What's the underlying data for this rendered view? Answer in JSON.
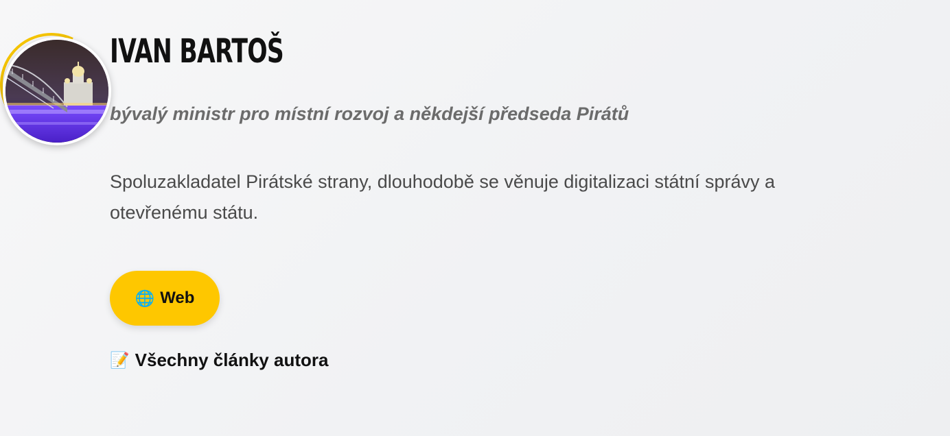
{
  "author": {
    "name": "IVAN BARTOŠ",
    "role": "bývalý ministr pro místní rozvoj a někdejší předseda Pirátů",
    "bio": "Spoluzakladatel Pirátské strany, dlouhodobě se věnuje digitalizaci státní správy a otevřenému státu.",
    "avatar_alt": "avatar"
  },
  "links": {
    "web": {
      "icon": "🌐",
      "icon_name": "globe-icon",
      "label": "Web"
    },
    "all_articles": {
      "icon": "📝",
      "icon_name": "memo-icon",
      "label": "Všechny články autora"
    }
  },
  "colors": {
    "accent": "#fec700",
    "name": "#111111",
    "role": "#6b6b6b",
    "bio": "#4a4a4a"
  }
}
